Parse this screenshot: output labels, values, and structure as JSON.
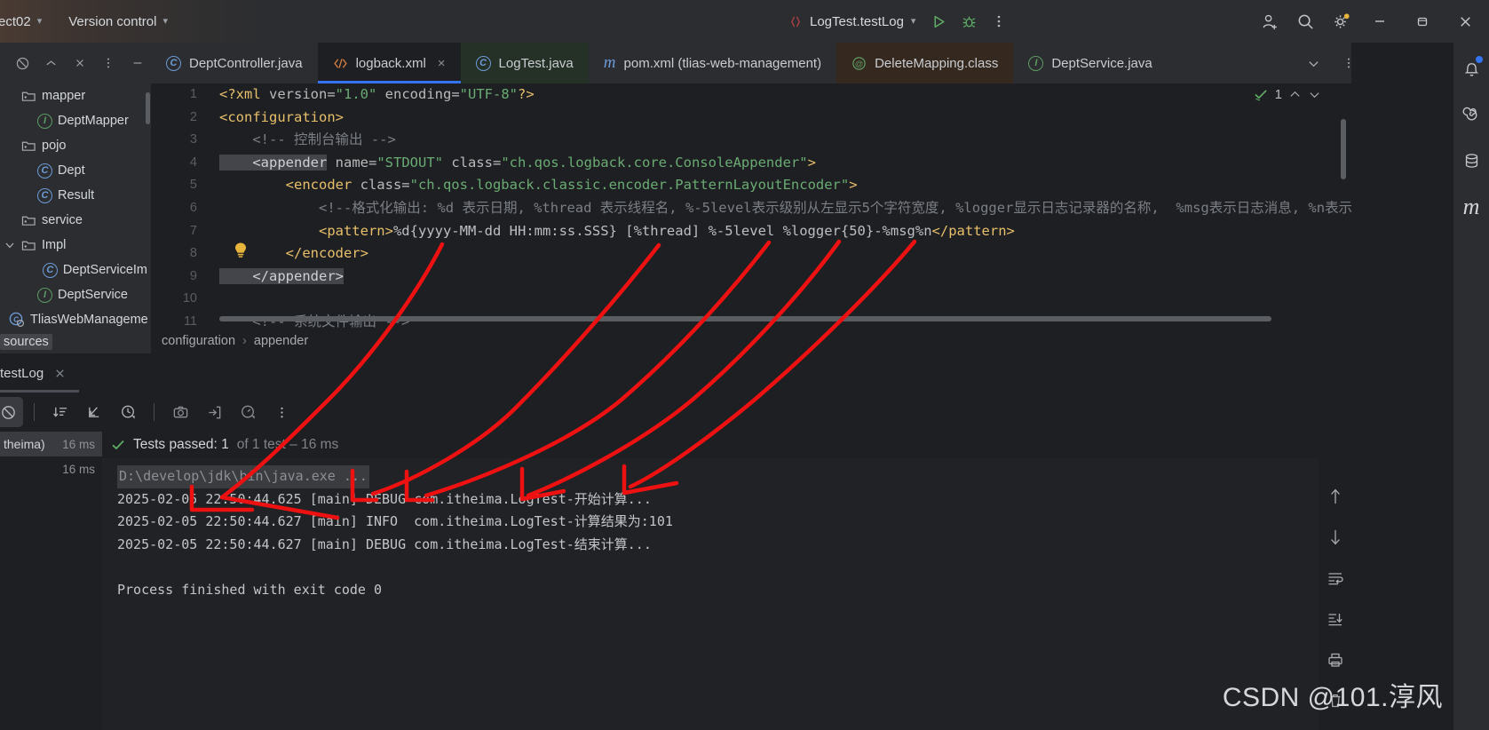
{
  "titlebar": {
    "project_name": "ect02",
    "vcs_label": "Version control",
    "run_config": "LogTest.testLog",
    "icons": {
      "run": "run-icon",
      "debug": "debug-icon",
      "more": "more-vertical-icon",
      "add_user": "add-user-icon",
      "search": "search-icon",
      "settings": "gear-icon",
      "minimize": "minimize-icon",
      "maximize": "restore-icon",
      "close": "close-icon"
    }
  },
  "project_panel": {
    "tree": [
      {
        "label": "mapper",
        "kind": "folder",
        "indent": 0,
        "expander": ""
      },
      {
        "label": "DeptMapper",
        "kind": "interface",
        "indent": 1,
        "expander": ""
      },
      {
        "label": "pojo",
        "kind": "folder",
        "indent": 0,
        "expander": ""
      },
      {
        "label": "Dept",
        "kind": "class",
        "indent": 1,
        "expander": ""
      },
      {
        "label": "Result",
        "kind": "class",
        "indent": 1,
        "expander": ""
      },
      {
        "label": "service",
        "kind": "folder",
        "indent": 0,
        "expander": ""
      },
      {
        "label": "Impl",
        "kind": "folder",
        "indent": 0,
        "expander": "v"
      },
      {
        "label": "DeptServiceIm",
        "kind": "class",
        "indent": 2,
        "expander": ""
      },
      {
        "label": "DeptService",
        "kind": "interface",
        "indent": 1,
        "expander": ""
      },
      {
        "label": "TliasWebManageme",
        "kind": "spring",
        "indent": 0,
        "expander": ""
      }
    ],
    "resources_label": "sources"
  },
  "editor_tabs": [
    {
      "label": "DeptController.java",
      "icon": "class-icon",
      "state": "normal",
      "closable": false
    },
    {
      "label": "logback.xml",
      "icon": "xml-icon",
      "state": "active",
      "closable": true
    },
    {
      "label": "LogTest.java",
      "icon": "class-icon",
      "state": "green",
      "closable": false
    },
    {
      "label": "pom.xml (tlias-web-management)",
      "icon": "maven-icon",
      "state": "normal",
      "closable": false
    },
    {
      "label": "DeleteMapping.class",
      "icon": "annotation-icon",
      "state": "brown",
      "closable": false
    },
    {
      "label": "DeptService.java",
      "icon": "interface-icon",
      "state": "normal",
      "closable": false
    }
  ],
  "editor": {
    "inspection_count": "1",
    "lines": [
      {
        "n": "1",
        "segments": [
          {
            "t": "tag",
            "v": "<?xml"
          },
          {
            "t": "attr",
            "v": " version="
          },
          {
            "t": "str",
            "v": "\"1.0\""
          },
          {
            "t": "attr",
            "v": " encoding="
          },
          {
            "t": "str",
            "v": "\"UTF-8\""
          },
          {
            "t": "tag",
            "v": "?>"
          }
        ]
      },
      {
        "n": "2",
        "segments": [
          {
            "t": "tag",
            "v": "<configuration>"
          }
        ]
      },
      {
        "n": "3",
        "segments": [
          {
            "t": "cmt",
            "v": "    <!-- 控制台输出 -->"
          }
        ]
      },
      {
        "n": "4",
        "segments": [
          {
            "t": "sel",
            "v": "    <appender"
          },
          {
            "t": "attr",
            "v": " name="
          },
          {
            "t": "str",
            "v": "\"STDOUT\""
          },
          {
            "t": "attr",
            "v": " class="
          },
          {
            "t": "str",
            "v": "\"ch.qos.logback.core.ConsoleAppender\""
          },
          {
            "t": "tag",
            "v": ">"
          }
        ]
      },
      {
        "n": "5",
        "segments": [
          {
            "t": "tag",
            "v": "        <encoder"
          },
          {
            "t": "attr",
            "v": " class="
          },
          {
            "t": "str",
            "v": "\"ch.qos.logback.classic.encoder.PatternLayoutEncoder\""
          },
          {
            "t": "tag",
            "v": ">"
          }
        ]
      },
      {
        "n": "6",
        "segments": [
          {
            "t": "cmt",
            "v": "            <!--格式化输出: %d 表示日期, %thread 表示线程名, %-5level表示级别从左显示5个字符宽度, %logger显示日志记录器的名称,  %msg表示日志消息, %n表示换行符"
          }
        ]
      },
      {
        "n": "7",
        "segments": [
          {
            "t": "tag",
            "v": "            <pattern>"
          },
          {
            "t": "txt",
            "v": "%d{yyyy-MM-dd HH:mm:ss.SSS} [%thread] %-5level %logger{50}-%msg%n"
          },
          {
            "t": "tag",
            "v": "</pattern>"
          }
        ]
      },
      {
        "n": "8",
        "segments": [
          {
            "t": "tag",
            "v": "        </encoder>"
          }
        ]
      },
      {
        "n": "9",
        "segments": [
          {
            "t": "sel",
            "v": "    </appender>"
          }
        ]
      },
      {
        "n": "10",
        "segments": [
          {
            "t": "txt",
            "v": ""
          }
        ]
      },
      {
        "n": "11",
        "segments": [
          {
            "t": "cmt",
            "v": "    <!-- 系统文件输出 -->"
          }
        ]
      }
    ]
  },
  "breadcrumb": {
    "items": [
      "configuration",
      "appender"
    ],
    "separator": "›"
  },
  "run_panel": {
    "tab_label": "testLog",
    "test_list": [
      {
        "label": "theima)",
        "time": "16 ms",
        "selected": true
      },
      {
        "label": "",
        "time": "16 ms",
        "selected": false
      }
    ],
    "status_text": "Tests passed: 1",
    "status_dim": "of 1 test – 16 ms",
    "console_lines": [
      {
        "type": "command",
        "text": "D:\\develop\\jdk\\bin\\java.exe ..."
      },
      {
        "type": "log",
        "text": "2025-02-05 22:50:44.625 [main] DEBUG com.itheima.LogTest-开始计算..."
      },
      {
        "type": "log",
        "text": "2025-02-05 22:50:44.627 [main] INFO  com.itheima.LogTest-计算结果为:101"
      },
      {
        "type": "log",
        "text": "2025-02-05 22:50:44.627 [main] DEBUG com.itheima.LogTest-结束计算..."
      },
      {
        "type": "blank",
        "text": ""
      },
      {
        "type": "log",
        "text": "Process finished with exit code 0"
      }
    ],
    "toolbar_icons": [
      "rerun-failed-icon",
      "sort-icon",
      "expand-icon",
      "history-icon",
      "camera-icon",
      "export-icon",
      "profile-icon",
      "more-vertical-icon"
    ],
    "console_side_icons": [
      "scroll-up-icon",
      "scroll-down-icon",
      "soft-wrap-icon",
      "scroll-to-end-icon",
      "print-icon",
      "trash-icon"
    ]
  },
  "right_stripe": {
    "icons": [
      "notifications-icon",
      "spiral-icon",
      "database-icon",
      "maven-icon"
    ]
  },
  "watermark": "CSDN @101.淳风",
  "colors": {
    "accent_blue": "#3574f0",
    "green": "#5d9b63",
    "annotation_red": "#ee1111",
    "bg_editor": "#1e1f22",
    "bg_panel": "#2b2d30"
  }
}
